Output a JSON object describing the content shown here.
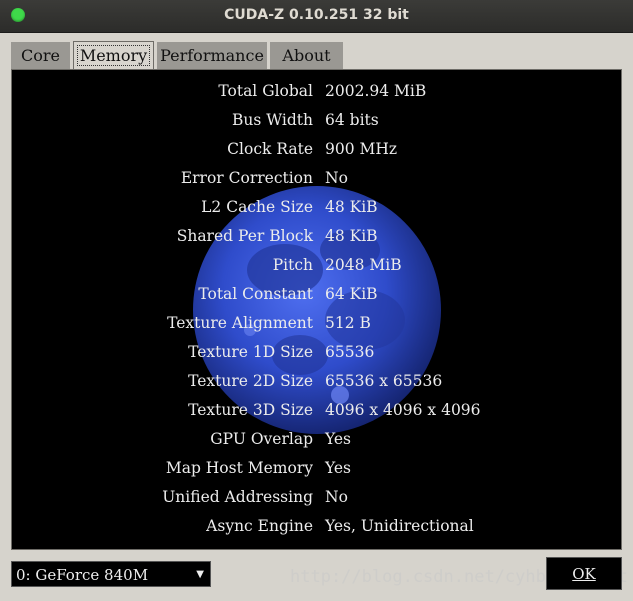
{
  "window": {
    "title": "CUDA-Z 0.10.251 32 bit"
  },
  "tabs": [
    {
      "label": "Core"
    },
    {
      "label": "Memory"
    },
    {
      "label": "Performance"
    },
    {
      "label": "About"
    }
  ],
  "memory": [
    {
      "label": "Total Global",
      "value": "2002.94 MiB"
    },
    {
      "label": "Bus Width",
      "value": "64 bits"
    },
    {
      "label": "Clock Rate",
      "value": "900 MHz"
    },
    {
      "label": "Error Correction",
      "value": "No"
    },
    {
      "label": "L2 Cache Size",
      "value": "48 KiB"
    },
    {
      "label": "Shared Per Block",
      "value": "48 KiB"
    },
    {
      "label": "Pitch",
      "value": "2048 MiB"
    },
    {
      "label": "Total Constant",
      "value": "64 KiB"
    },
    {
      "label": "Texture Alignment",
      "value": "512 B"
    },
    {
      "label": "Texture 1D Size",
      "value": "65536"
    },
    {
      "label": "Texture 2D Size",
      "value": "65536 x 65536"
    },
    {
      "label": "Texture 3D Size",
      "value": "4096 x 4096 x 4096"
    },
    {
      "label": "GPU Overlap",
      "value": "Yes"
    },
    {
      "label": "Map Host Memory",
      "value": "Yes"
    },
    {
      "label": "Unified Addressing",
      "value": "No"
    },
    {
      "label": "Async Engine",
      "value": "Yes, Unidirectional"
    }
  ],
  "device_select": {
    "value": "0: GeForce 840M"
  },
  "ok_button": {
    "label": "OK"
  },
  "watermark": "http://blog.csdn.net/cyhbrilliant",
  "colors": {
    "accent": "#3fd94a",
    "moon": "#2c47b8"
  }
}
